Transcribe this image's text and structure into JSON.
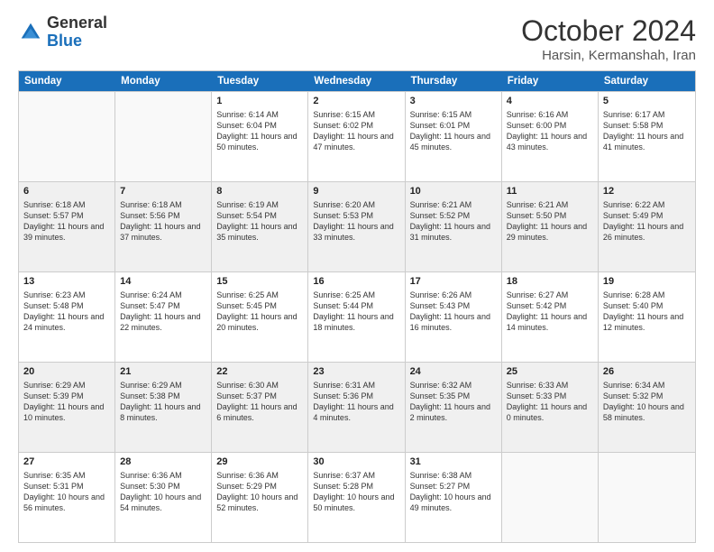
{
  "header": {
    "logo": {
      "line1": "General",
      "line2": "Blue"
    },
    "title": "October 2024",
    "location": "Harsin, Kermanshah, Iran"
  },
  "days_of_week": [
    "Sunday",
    "Monday",
    "Tuesday",
    "Wednesday",
    "Thursday",
    "Friday",
    "Saturday"
  ],
  "weeks": [
    [
      {
        "day": "",
        "info": "",
        "empty": true
      },
      {
        "day": "",
        "info": "",
        "empty": true
      },
      {
        "day": "1",
        "info": "Sunrise: 6:14 AM\nSunset: 6:04 PM\nDaylight: 11 hours and 50 minutes."
      },
      {
        "day": "2",
        "info": "Sunrise: 6:15 AM\nSunset: 6:02 PM\nDaylight: 11 hours and 47 minutes."
      },
      {
        "day": "3",
        "info": "Sunrise: 6:15 AM\nSunset: 6:01 PM\nDaylight: 11 hours and 45 minutes."
      },
      {
        "day": "4",
        "info": "Sunrise: 6:16 AM\nSunset: 6:00 PM\nDaylight: 11 hours and 43 minutes."
      },
      {
        "day": "5",
        "info": "Sunrise: 6:17 AM\nSunset: 5:58 PM\nDaylight: 11 hours and 41 minutes."
      }
    ],
    [
      {
        "day": "6",
        "info": "Sunrise: 6:18 AM\nSunset: 5:57 PM\nDaylight: 11 hours and 39 minutes."
      },
      {
        "day": "7",
        "info": "Sunrise: 6:18 AM\nSunset: 5:56 PM\nDaylight: 11 hours and 37 minutes."
      },
      {
        "day": "8",
        "info": "Sunrise: 6:19 AM\nSunset: 5:54 PM\nDaylight: 11 hours and 35 minutes."
      },
      {
        "day": "9",
        "info": "Sunrise: 6:20 AM\nSunset: 5:53 PM\nDaylight: 11 hours and 33 minutes."
      },
      {
        "day": "10",
        "info": "Sunrise: 6:21 AM\nSunset: 5:52 PM\nDaylight: 11 hours and 31 minutes."
      },
      {
        "day": "11",
        "info": "Sunrise: 6:21 AM\nSunset: 5:50 PM\nDaylight: 11 hours and 29 minutes."
      },
      {
        "day": "12",
        "info": "Sunrise: 6:22 AM\nSunset: 5:49 PM\nDaylight: 11 hours and 26 minutes."
      }
    ],
    [
      {
        "day": "13",
        "info": "Sunrise: 6:23 AM\nSunset: 5:48 PM\nDaylight: 11 hours and 24 minutes."
      },
      {
        "day": "14",
        "info": "Sunrise: 6:24 AM\nSunset: 5:47 PM\nDaylight: 11 hours and 22 minutes."
      },
      {
        "day": "15",
        "info": "Sunrise: 6:25 AM\nSunset: 5:45 PM\nDaylight: 11 hours and 20 minutes."
      },
      {
        "day": "16",
        "info": "Sunrise: 6:25 AM\nSunset: 5:44 PM\nDaylight: 11 hours and 18 minutes."
      },
      {
        "day": "17",
        "info": "Sunrise: 6:26 AM\nSunset: 5:43 PM\nDaylight: 11 hours and 16 minutes."
      },
      {
        "day": "18",
        "info": "Sunrise: 6:27 AM\nSunset: 5:42 PM\nDaylight: 11 hours and 14 minutes."
      },
      {
        "day": "19",
        "info": "Sunrise: 6:28 AM\nSunset: 5:40 PM\nDaylight: 11 hours and 12 minutes."
      }
    ],
    [
      {
        "day": "20",
        "info": "Sunrise: 6:29 AM\nSunset: 5:39 PM\nDaylight: 11 hours and 10 minutes."
      },
      {
        "day": "21",
        "info": "Sunrise: 6:29 AM\nSunset: 5:38 PM\nDaylight: 11 hours and 8 minutes."
      },
      {
        "day": "22",
        "info": "Sunrise: 6:30 AM\nSunset: 5:37 PM\nDaylight: 11 hours and 6 minutes."
      },
      {
        "day": "23",
        "info": "Sunrise: 6:31 AM\nSunset: 5:36 PM\nDaylight: 11 hours and 4 minutes."
      },
      {
        "day": "24",
        "info": "Sunrise: 6:32 AM\nSunset: 5:35 PM\nDaylight: 11 hours and 2 minutes."
      },
      {
        "day": "25",
        "info": "Sunrise: 6:33 AM\nSunset: 5:33 PM\nDaylight: 11 hours and 0 minutes."
      },
      {
        "day": "26",
        "info": "Sunrise: 6:34 AM\nSunset: 5:32 PM\nDaylight: 10 hours and 58 minutes."
      }
    ],
    [
      {
        "day": "27",
        "info": "Sunrise: 6:35 AM\nSunset: 5:31 PM\nDaylight: 10 hours and 56 minutes."
      },
      {
        "day": "28",
        "info": "Sunrise: 6:36 AM\nSunset: 5:30 PM\nDaylight: 10 hours and 54 minutes."
      },
      {
        "day": "29",
        "info": "Sunrise: 6:36 AM\nSunset: 5:29 PM\nDaylight: 10 hours and 52 minutes."
      },
      {
        "day": "30",
        "info": "Sunrise: 6:37 AM\nSunset: 5:28 PM\nDaylight: 10 hours and 50 minutes."
      },
      {
        "day": "31",
        "info": "Sunrise: 6:38 AM\nSunset: 5:27 PM\nDaylight: 10 hours and 49 minutes."
      },
      {
        "day": "",
        "info": "",
        "empty": true
      },
      {
        "day": "",
        "info": "",
        "empty": true
      }
    ]
  ]
}
